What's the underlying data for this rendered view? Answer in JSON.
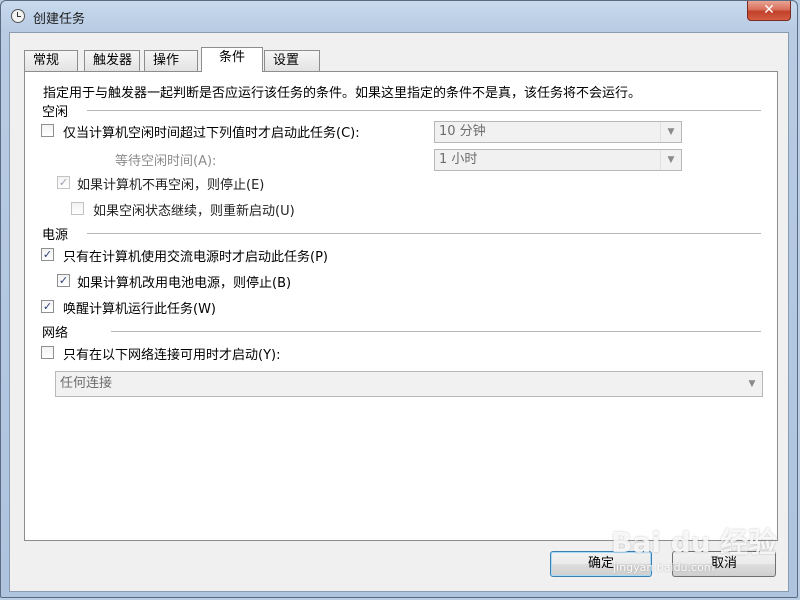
{
  "window": {
    "title": "创建任务",
    "close_glyph": "✕"
  },
  "tabs": [
    {
      "label": "常规",
      "active": false
    },
    {
      "label": "触发器",
      "active": false
    },
    {
      "label": "操作",
      "active": false
    },
    {
      "label": "条件",
      "active": true
    },
    {
      "label": "设置",
      "active": false
    }
  ],
  "panel": {
    "description": "指定用于与触发器一起判断是否应运行该任务的条件。如果这里指定的条件不是真，该任务将不会运行。",
    "idle": {
      "group_label": "空闲",
      "start_if_idle": {
        "label": "仅当计算机空闲时间超过下列值时才启动此任务(C):",
        "checked": false
      },
      "idle_duration": {
        "value": "10 分钟"
      },
      "wait_label": "等待空闲时间(A):",
      "wait_duration": {
        "value": "1 小时"
      },
      "stop_if_not_idle": {
        "label": "如果计算机不再空闲，则停止(E)",
        "checked": true,
        "disabled": true
      },
      "restart_if_idle": {
        "label": "如果空闲状态继续，则重新启动(U)",
        "checked": false,
        "disabled": true
      }
    },
    "power": {
      "group_label": "电源",
      "ac_only": {
        "label": "只有在计算机使用交流电源时才启动此任务(P)",
        "checked": true
      },
      "stop_on_battery": {
        "label": "如果计算机改用电池电源，则停止(B)",
        "checked": true
      },
      "wake_to_run": {
        "label": "唤醒计算机运行此任务(W)",
        "checked": true
      }
    },
    "network": {
      "group_label": "网络",
      "network_only": {
        "label": "只有在以下网络连接可用时才启动(Y):",
        "checked": false
      },
      "connection": {
        "value": "任何连接"
      }
    }
  },
  "buttons": {
    "ok": "确定",
    "cancel": "取消"
  },
  "watermark": {
    "text": "Bai du 经验",
    "sub": "jingyan.baidu.com"
  },
  "icons": {
    "check": "✓",
    "dropdown": "▼"
  }
}
